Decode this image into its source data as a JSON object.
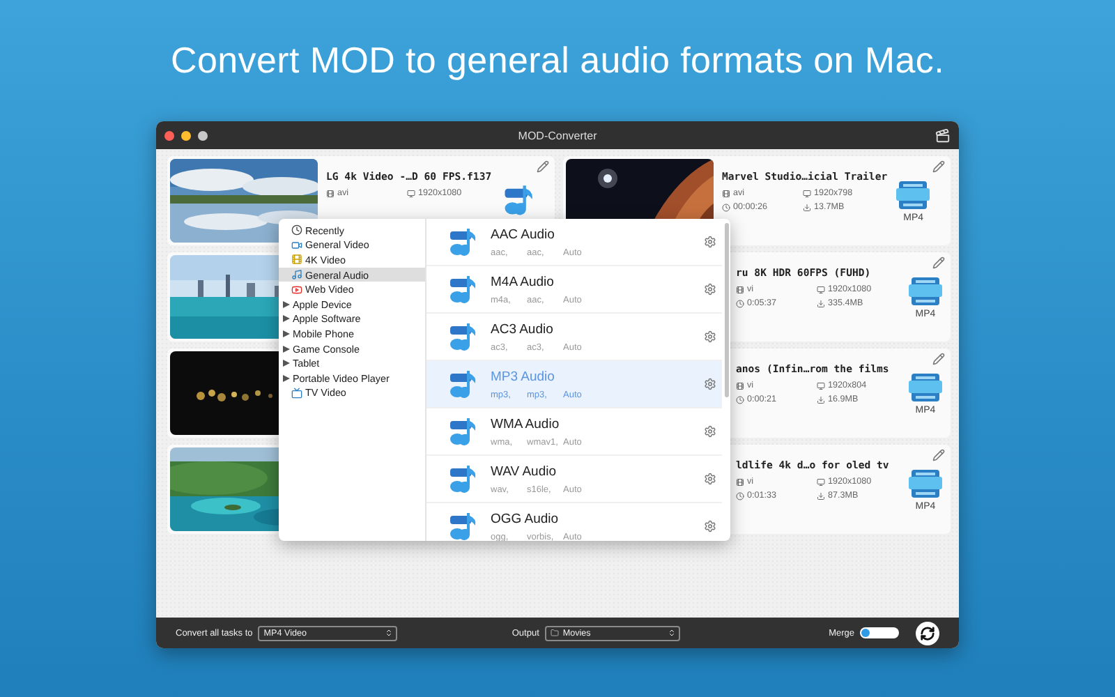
{
  "headline": "Convert MOD to general audio formats on Mac.",
  "window": {
    "title": "MOD-Converter"
  },
  "tasks": [
    {
      "thumbnail": {
        "kind": "picture"
      },
      "title": "LG 4k Video -…D 60 FPS.f137",
      "container": "avi",
      "resolution": "1920x1080",
      "output": {
        "kind": "audio"
      }
    },
    {
      "thumbnail": {
        "kind": "picture"
      },
      "title": "Marvel Studio…icial Trailer",
      "container": "avi",
      "resolution": "1920x798",
      "duration": "00:00:26",
      "size": "13.7MB",
      "output": {
        "kind": "video",
        "label": "MP4"
      }
    },
    {
      "thumbnail": {
        "kind": "picture"
      }
    },
    {
      "title": "ru 8K HDR 60FPS (FUHD)",
      "container": "vi",
      "resolution": "1920x1080",
      "duration": "0:05:37",
      "size": "335.4MB",
      "output": {
        "kind": "video",
        "label": "MP4"
      }
    },
    {
      "thumbnail": {
        "kind": "picture"
      }
    },
    {
      "title": "anos (Infin…rom the films",
      "container": "vi",
      "resolution": "1920x804",
      "duration": "0:00:21",
      "size": "16.9MB",
      "output": {
        "kind": "video",
        "label": "MP4"
      }
    },
    {
      "thumbnail": {
        "kind": "picture"
      }
    },
    {
      "title": "ldlife 4k d…o for oled tv",
      "container": "vi",
      "resolution": "1920x1080",
      "duration": "0:01:33",
      "size": "87.3MB",
      "output": {
        "kind": "video",
        "label": "MP4"
      }
    }
  ],
  "format_menu": {
    "categories": [
      {
        "label": "Recently",
        "kind": "recent",
        "selected": false
      },
      {
        "label": "General Video",
        "kind": "video",
        "selected": false
      },
      {
        "label": "4K Video",
        "kind": "hd",
        "selected": false
      },
      {
        "label": "General Audio",
        "kind": "audio",
        "selected": true
      },
      {
        "label": "Web Video",
        "kind": "web",
        "selected": false
      },
      {
        "label": "Apple Device",
        "kind": "group",
        "selected": false
      },
      {
        "label": "Apple Software",
        "kind": "group",
        "selected": false
      },
      {
        "label": "Mobile Phone",
        "kind": "group",
        "selected": false
      },
      {
        "label": "Game Console",
        "kind": "group",
        "selected": false
      },
      {
        "label": "Tablet",
        "kind": "group",
        "selected": false
      },
      {
        "label": "Portable Video Player",
        "kind": "group",
        "selected": false
      },
      {
        "label": "TV Video",
        "kind": "tv",
        "selected": false
      }
    ],
    "formats": [
      {
        "name": "AAC Audio",
        "specs": [
          "aac,",
          "aac,",
          "Auto"
        ],
        "selected": false
      },
      {
        "name": "M4A Audio",
        "specs": [
          "m4a,",
          "aac,",
          "Auto"
        ],
        "selected": false
      },
      {
        "name": "AC3 Audio",
        "specs": [
          "ac3,",
          "ac3,",
          "Auto"
        ],
        "selected": false
      },
      {
        "name": "MP3 Audio",
        "specs": [
          "mp3,",
          "mp3,",
          "Auto"
        ],
        "selected": true
      },
      {
        "name": "WMA Audio",
        "specs": [
          "wma,",
          "wmav1,",
          "Auto"
        ],
        "selected": false
      },
      {
        "name": "WAV Audio",
        "specs": [
          "wav,",
          "s16le,",
          "Auto"
        ],
        "selected": false
      },
      {
        "name": "OGG Audio",
        "specs": [
          "ogg,",
          "vorbis,",
          "Auto"
        ],
        "selected": false
      }
    ]
  },
  "footer": {
    "convert_label": "Convert all tasks to",
    "convert_value": "MP4 Video",
    "output_label": "Output",
    "output_value": "Movies",
    "merge_label": "Merge",
    "merge_on": false
  }
}
